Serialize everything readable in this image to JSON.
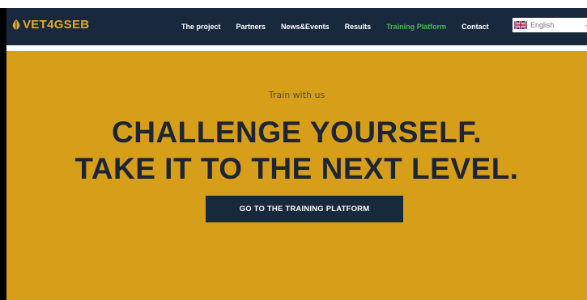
{
  "nav": {
    "logo_text": "VET4GSEB",
    "items": [
      {
        "label": "The project"
      },
      {
        "label": "Partners"
      },
      {
        "label": "News&Events"
      },
      {
        "label": "Results"
      },
      {
        "label": "Training Platform",
        "active": true
      },
      {
        "label": "Contact"
      }
    ],
    "language": "English"
  },
  "hero": {
    "eyebrow": "Train with us",
    "headline_line1": "CHALLENGE YOURSELF.",
    "headline_line2": "TAKE IT TO THE NEXT LEVEL.",
    "cta_label": "GO TO THE TRAINING PLATFORM"
  },
  "colors": {
    "navbar_bg": "#18283d",
    "hero_bg": "#d79f19",
    "active_nav": "#3fbf4a",
    "headline": "#1c2436",
    "logo": "#e3a82a"
  },
  "icons": {
    "logo": "vet4gseb-leaf-logo-icon",
    "flag": "uk-flag-icon",
    "chevron": "chevron-down-icon"
  }
}
